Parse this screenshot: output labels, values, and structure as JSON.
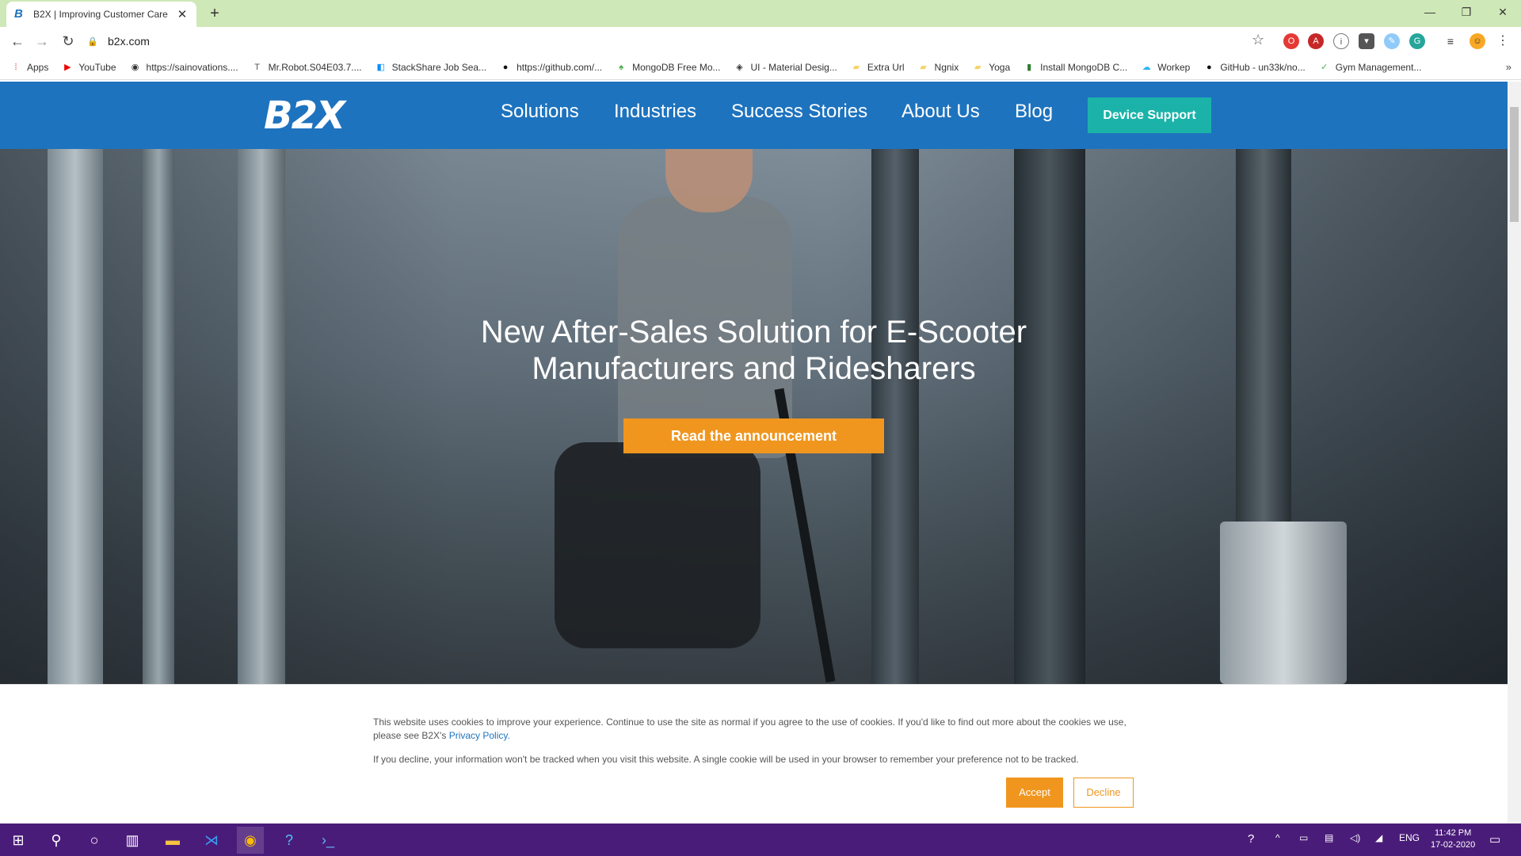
{
  "browser": {
    "tab_title": "B2X | Improving Customer Care",
    "tab_favicon": "B",
    "url": "b2x.com",
    "bookmarks": [
      {
        "label": "Apps",
        "icon": "apps-grid-icon",
        "color": "#e53935"
      },
      {
        "label": "YouTube",
        "icon": "youtube-icon",
        "color": "#e00"
      },
      {
        "label": "https://sainovations....",
        "icon": "globe-icon",
        "color": "#333"
      },
      {
        "label": "Mr.Robot.S04E03.7....",
        "icon": "text-icon",
        "color": "#555"
      },
      {
        "label": "StackShare Job Sea...",
        "icon": "stackshare-icon",
        "color": "#0690fa"
      },
      {
        "label": "https://github.com/...",
        "icon": "github-icon",
        "color": "#111"
      },
      {
        "label": "MongoDB Free Mo...",
        "icon": "mongodb-leaf-icon",
        "color": "#4caf50"
      },
      {
        "label": "UI - Material Desig...",
        "icon": "material-icon",
        "color": "#333"
      },
      {
        "label": "Extra Url",
        "icon": "folder-icon",
        "color": "#f6d365"
      },
      {
        "label": "Ngnix",
        "icon": "folder-icon",
        "color": "#f6d365"
      },
      {
        "label": "Yoga",
        "icon": "folder-icon",
        "color": "#f6d365"
      },
      {
        "label": "Install MongoDB C...",
        "icon": "mongodb-icon",
        "color": "#2e7d32"
      },
      {
        "label": "Workep",
        "icon": "cloud-icon",
        "color": "#29b6f6"
      },
      {
        "label": "GitHub - un33k/no...",
        "icon": "github-icon",
        "color": "#111"
      },
      {
        "label": "Gym Management...",
        "icon": "check-icon",
        "color": "#4caf50"
      }
    ]
  },
  "site": {
    "logo": "B2X",
    "nav": [
      "Solutions",
      "Industries",
      "Success Stories",
      "About Us",
      "Blog"
    ],
    "cta": "Device Support",
    "hero_title_line1": "New After-Sales Solution for E-Scooter",
    "hero_title_line2": "Manufacturers and Ridesharers",
    "hero_button": "Read the announcement"
  },
  "cookie": {
    "text1": "This website uses cookies to improve your experience. Continue to use the site as normal if you agree to the use of cookies. If you'd like to find out more about the cookies we use, please see B2X's",
    "link": "Privacy Policy.",
    "text2": "If you decline, your information won't be tracked when you visit this website. A single cookie will be used in your browser to remember your preference not to be tracked.",
    "accept": "Accept",
    "decline": "Decline"
  },
  "taskbar": {
    "lang": "ENG",
    "time": "11:42 PM",
    "date": "17-02-2020"
  },
  "colors": {
    "brand_blue": "#1e73be",
    "teal": "#1bb3a9",
    "orange": "#f0961f",
    "taskbar": "#4a1c7a"
  }
}
